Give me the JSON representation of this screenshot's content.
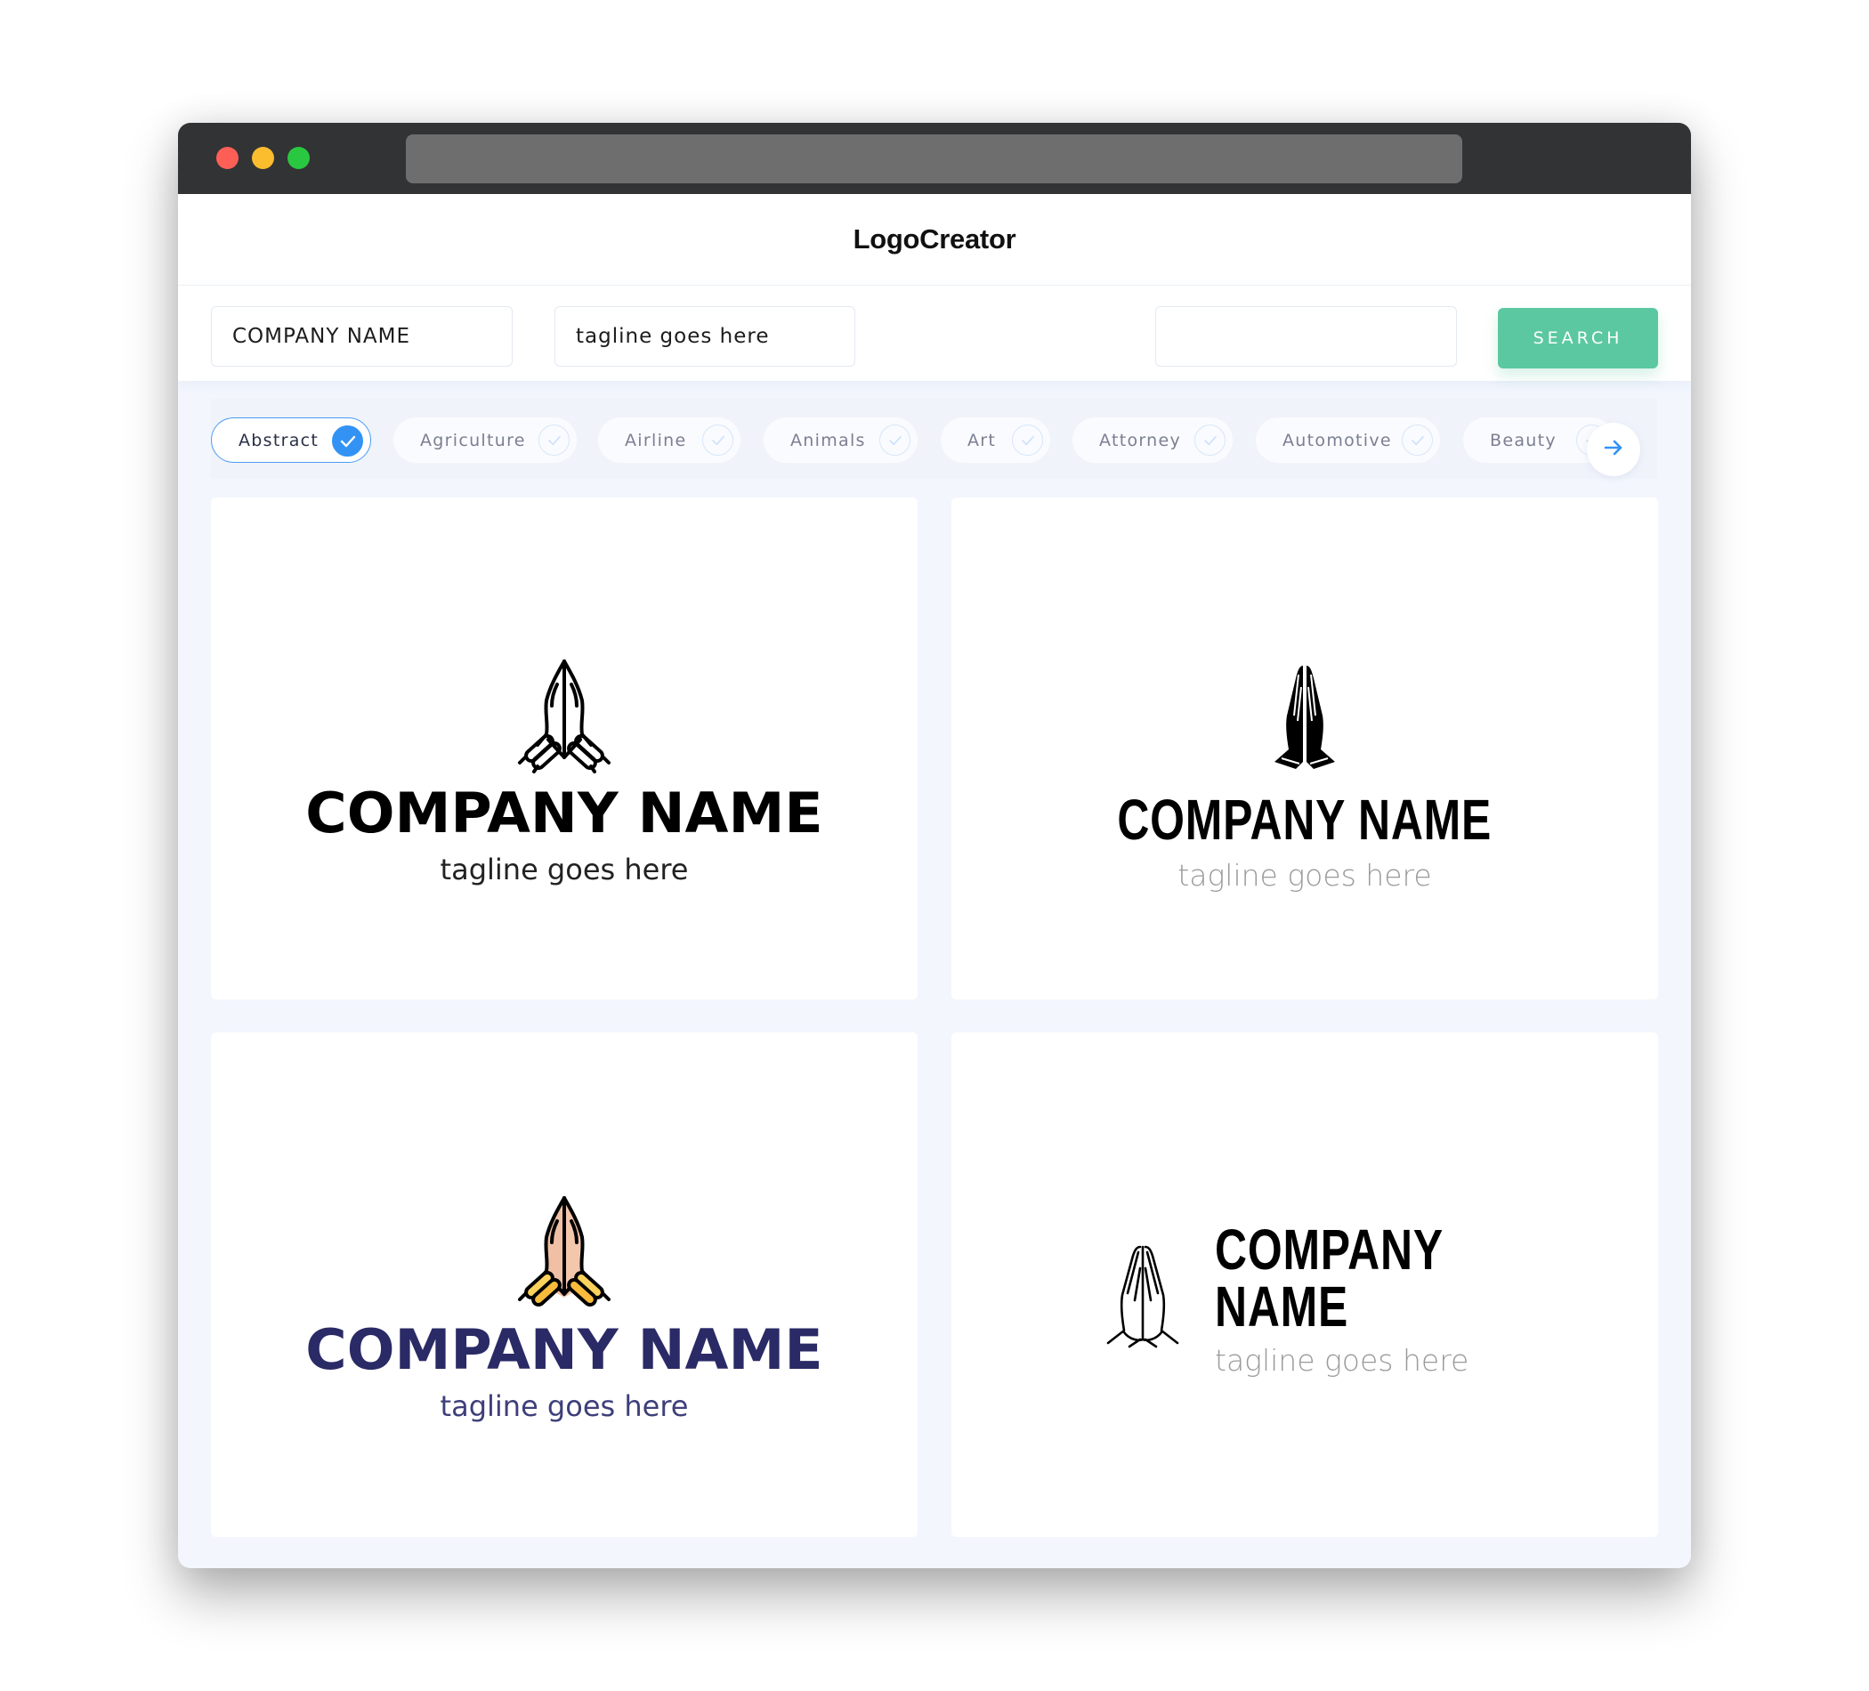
{
  "app": {
    "title": "LogoCreator"
  },
  "search": {
    "company_value": "COMPANY NAME",
    "tagline_value": "tagline goes here",
    "keyword_value": "",
    "button_label": "SEARCH"
  },
  "categories": [
    {
      "label": "Abstract",
      "selected": true
    },
    {
      "label": "Agriculture",
      "selected": false
    },
    {
      "label": "Airline",
      "selected": false
    },
    {
      "label": "Animals",
      "selected": false
    },
    {
      "label": "Art",
      "selected": false
    },
    {
      "label": "Attorney",
      "selected": false
    },
    {
      "label": "Automotive",
      "selected": false
    },
    {
      "label": "Beauty",
      "selected": false
    }
  ],
  "next_icon": "arrow-right-icon",
  "logos": [
    {
      "icon": "praying-hands-outline-bangles-icon",
      "company": "COMPANY NAME",
      "tagline": "tagline goes here",
      "name_color": "#000000",
      "tagline_color": "#222222"
    },
    {
      "icon": "praying-hands-solid-icon",
      "company": "COMPANY NAME",
      "tagline": "tagline goes here",
      "name_color": "#000000",
      "tagline_color": "#9a9a9a"
    },
    {
      "icon": "praying-hands-color-bangles-icon",
      "company": "COMPANY NAME",
      "tagline": "tagline goes here",
      "name_color": "#2a2a66",
      "tagline_color": "#3e3f7a"
    },
    {
      "icon": "praying-hands-line-icon",
      "company": "COMPANY NAME",
      "tagline": "tagline goes here",
      "name_color": "#000000",
      "tagline_color": "#9a9a9a"
    }
  ],
  "colors": {
    "accent": "#3293f5",
    "search_button": "#5bc8a1",
    "titlebar": "#323335",
    "background": "#f3f6fd"
  }
}
